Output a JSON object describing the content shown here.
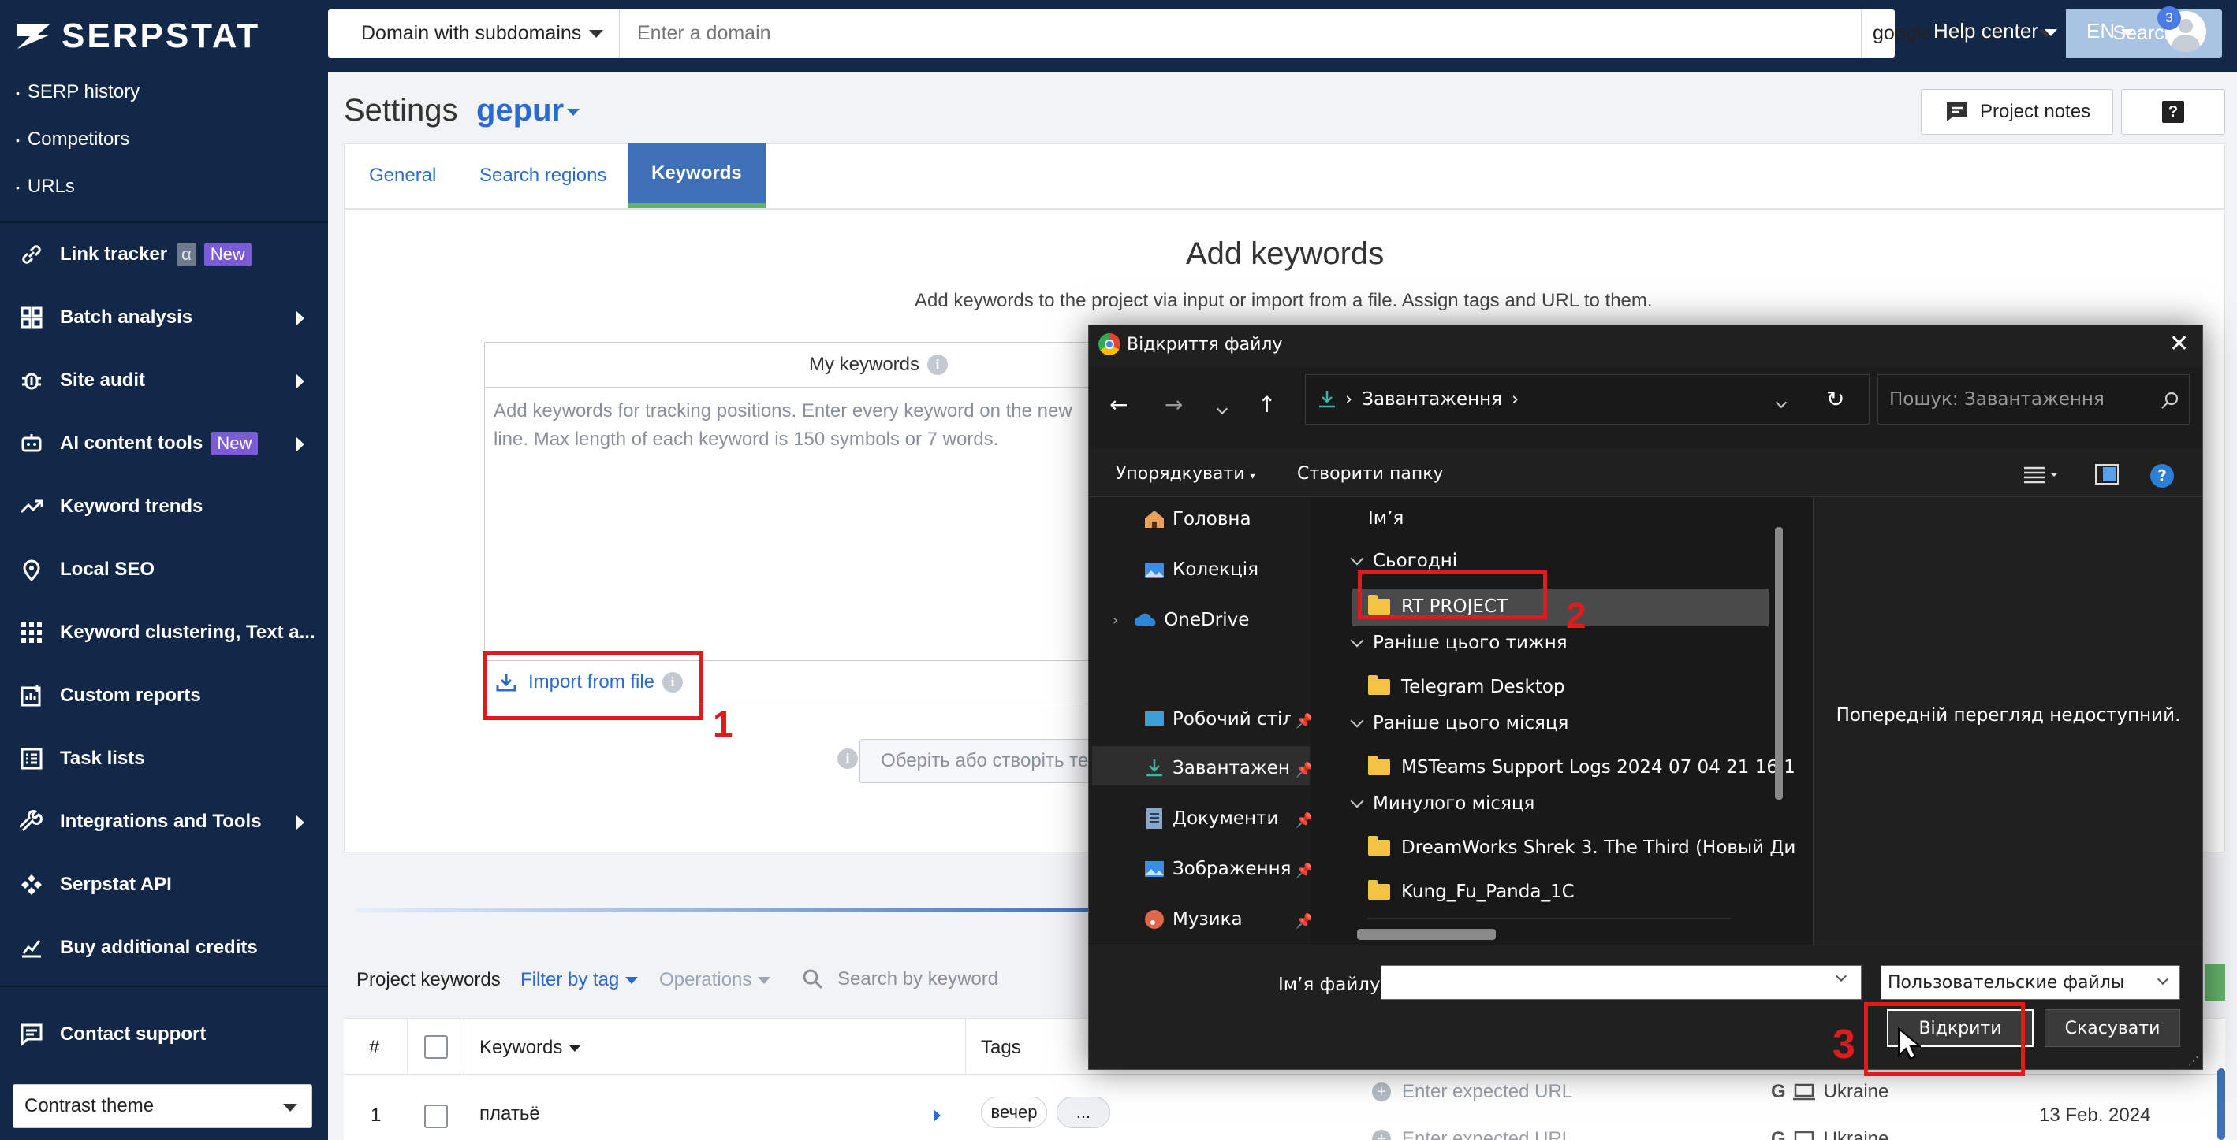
{
  "header": {
    "logo": "SERPSTAT",
    "scope": "Domain with subdomains",
    "domain_placeholder": "Enter a domain",
    "engine": "google.com.ua",
    "search": "Search",
    "help": "Help center",
    "lang": "EN",
    "notifications": "3"
  },
  "sidebar": {
    "sub_items": [
      "SERP history",
      "Competitors",
      "URLs"
    ],
    "items": [
      {
        "label": "Link tracker",
        "icon": "link-icon",
        "alpha": "α",
        "badge": "New"
      },
      {
        "label": "Batch analysis",
        "icon": "grid-icon"
      },
      {
        "label": "Site audit",
        "icon": "bug-icon"
      },
      {
        "label": "AI content tools",
        "icon": "robot-icon",
        "badge": "New"
      },
      {
        "label": "Keyword trends",
        "icon": "trend-icon"
      },
      {
        "label": "Local SEO",
        "icon": "pin-icon"
      },
      {
        "label": "Keyword clustering, Text a...",
        "icon": "dots-grid-icon"
      },
      {
        "label": "Custom reports",
        "icon": "report-icon"
      },
      {
        "label": "Task lists",
        "icon": "list-icon"
      },
      {
        "label": "Integrations and Tools",
        "icon": "wrench-icon"
      },
      {
        "label": "Serpstat API",
        "icon": "api-icon"
      },
      {
        "label": "Buy additional credits",
        "icon": "credits-icon"
      }
    ],
    "contact": "Contact support",
    "theme": "Contrast theme"
  },
  "main": {
    "title": "Settings",
    "project": "gepur",
    "project_notes": "Project notes",
    "help_q": "?",
    "tabs": [
      "General",
      "Search regions",
      "Keywords"
    ],
    "add_title": "Add keywords",
    "add_sub": "Add keywords to the project via input or import from a file. Assign tags and URL to them.",
    "my_keywords": "My keywords",
    "kw_placeholder": "Add keywords for tracking positions. Enter every keyword on the new line. Max length of each keyword is 150 symbols or 7 words.",
    "import": "Import from file",
    "tag_placeholder": "Оберіть або створіть тег",
    "annotations": [
      "1",
      "2",
      "3"
    ]
  },
  "table": {
    "title": "Project keywords",
    "filter": "Filter by tag",
    "operations": "Operations",
    "search_placeholder": "Search by keyword",
    "headers": {
      "num": "#",
      "keywords": "Keywords",
      "tags": "Tags"
    },
    "rows": [
      {
        "num": "1",
        "keyword": "платьё",
        "tag": "вечер",
        "more": "...",
        "url_placeholder": "Enter expected URL",
        "region": "Ukraine",
        "date": "13 Feb. 2024"
      }
    ],
    "row2": {
      "url_placeholder": "Enter expected URL",
      "region": "Ukraine"
    }
  },
  "dialog": {
    "title": "Відкриття файлу",
    "path": "Завантаження",
    "search_placeholder": "Пошук: Завантаження",
    "organize": "Упорядкувати",
    "new_folder": "Створити папку",
    "nav": [
      {
        "label": "Головна",
        "icon": "home-icon"
      },
      {
        "label": "Колекція",
        "icon": "gallery-icon"
      },
      {
        "label": "OneDrive",
        "icon": "cloud-icon"
      },
      {
        "label": "Робочий стіл",
        "icon": "desktop-icon"
      },
      {
        "label": "Завантаження",
        "icon": "download-icon"
      },
      {
        "label": "Документи",
        "icon": "document-icon"
      },
      {
        "label": "Зображення",
        "icon": "image-icon"
      },
      {
        "label": "Музика",
        "icon": "music-icon"
      }
    ],
    "column": "Ім’я",
    "groups": [
      {
        "label": "Сьогодні",
        "files": [
          "RT PROJECT"
        ]
      },
      {
        "label": "Раніше цього тижня",
        "files": [
          "Telegram Desktop"
        ]
      },
      {
        "label": "Раніше цього місяця",
        "files": [
          "MSTeams Support Logs 2024 07 04 21 16 1"
        ]
      },
      {
        "label": "Минулого місяця",
        "files": [
          "DreamWorks Shrek 3. The Third (Новый Ди",
          "Kung_Fu_Panda_1C"
        ]
      }
    ],
    "preview": "Попередній перегляд недоступний.",
    "file_name_label": "Ім’я файлу:",
    "file_name": "",
    "file_type": "Пользовательские файлы",
    "open": "Відкрити",
    "cancel": "Скасувати"
  },
  "colors": {
    "brand": "#132849",
    "accent": "#2a6bd1",
    "annotation": "#e01b1b"
  }
}
